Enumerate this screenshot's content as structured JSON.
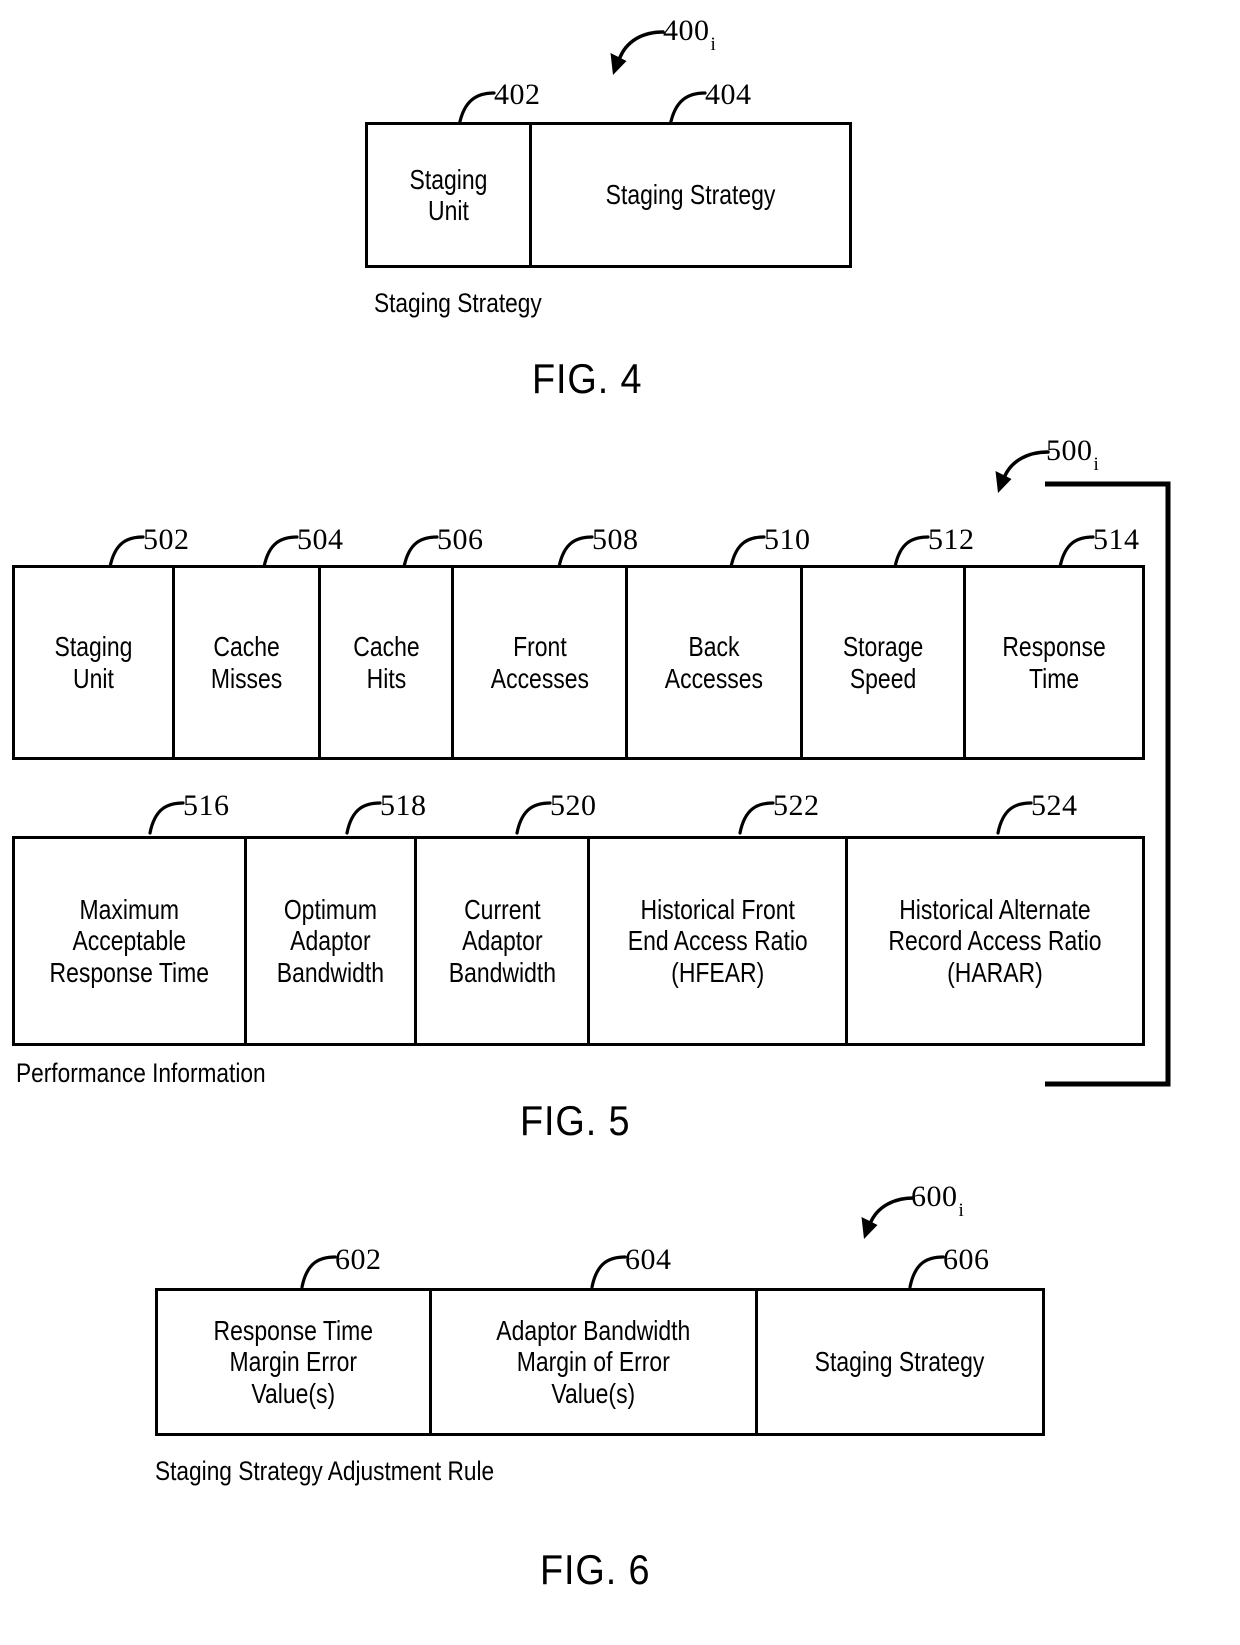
{
  "figures": [
    {
      "id": "fig4",
      "number_label": "FIG. 4",
      "ref": "400",
      "ref_sub": "i",
      "caption": "Staging Strategy",
      "rows": [
        {
          "cells": [
            {
              "ref": "402",
              "label": "Staging\nUnit"
            },
            {
              "ref": "404",
              "label": "Staging Strategy"
            }
          ]
        }
      ]
    },
    {
      "id": "fig5",
      "number_label": "FIG. 5",
      "ref": "500",
      "ref_sub": "i",
      "caption": "Performance Information",
      "rows": [
        {
          "cells": [
            {
              "ref": "502",
              "label": "Staging\nUnit"
            },
            {
              "ref": "504",
              "label": "Cache\nMisses"
            },
            {
              "ref": "506",
              "label": "Cache\nHits"
            },
            {
              "ref": "508",
              "label": "Front\nAccesses"
            },
            {
              "ref": "510",
              "label": "Back\nAccesses"
            },
            {
              "ref": "512",
              "label": "Storage\nSpeed"
            },
            {
              "ref": "514",
              "label": "Response\nTime"
            }
          ]
        },
        {
          "cells": [
            {
              "ref": "516",
              "label": "Maximum\nAcceptable\nResponse Time"
            },
            {
              "ref": "518",
              "label": "Optimum\nAdaptor\nBandwidth"
            },
            {
              "ref": "520",
              "label": "Current\nAdaptor\nBandwidth"
            },
            {
              "ref": "522",
              "label": "Historical Front\nEnd Access Ratio\n(HFEAR)"
            },
            {
              "ref": "524",
              "label": "Historical Alternate\nRecord Access Ratio\n(HARAR)"
            }
          ]
        }
      ]
    },
    {
      "id": "fig6",
      "number_label": "FIG. 6",
      "ref": "600",
      "ref_sub": "i",
      "caption": "Staging Strategy Adjustment Rule",
      "rows": [
        {
          "cells": [
            {
              "ref": "602",
              "label": "Response Time\nMargin Error\nValue(s)"
            },
            {
              "ref": "604",
              "label": "Adaptor Bandwidth\nMargin of Error\nValue(s)"
            },
            {
              "ref": "606",
              "label": "Staging Strategy"
            }
          ]
        }
      ]
    }
  ],
  "colors": {
    "line": "#000000",
    "background": "#ffffff",
    "text": "#000000"
  }
}
